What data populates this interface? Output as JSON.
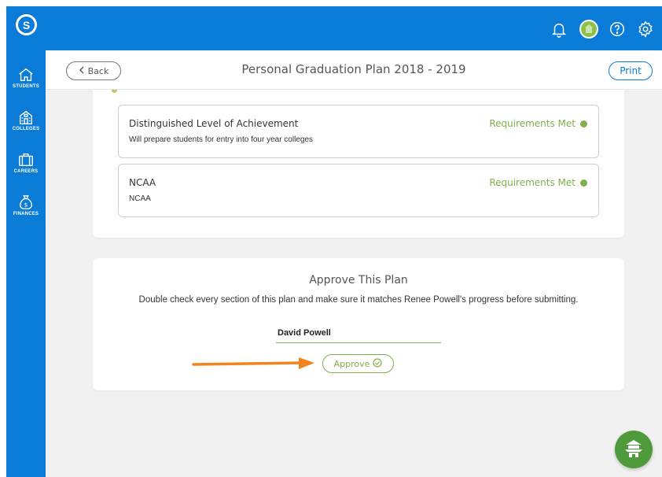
{
  "colors": {
    "brand_blue": "#0a7bd6",
    "accent_green": "#7fb04a",
    "arrow_orange": "#f2841e",
    "fab_green": "#4f9a3a"
  },
  "topbar": {
    "logo_letter": "S",
    "icons": [
      "bell-icon",
      "avatar",
      "help-icon",
      "settings-icon"
    ]
  },
  "sidebar": {
    "items": [
      {
        "label": "STUDENTS",
        "icon": "house-icon"
      },
      {
        "label": "COLLEGES",
        "icon": "building-icon"
      },
      {
        "label": "CAREERS",
        "icon": "briefcase-icon"
      },
      {
        "label": "FINANCES",
        "icon": "money-bag-icon"
      }
    ]
  },
  "header": {
    "back_label": "Back",
    "title": "Personal Graduation Plan 2018 - 2019",
    "print_label": "Print"
  },
  "requirements": [
    {
      "title": "Distinguished Level of Achievement",
      "description": "Will prepare students for entry into four year colleges",
      "status": "Requirements Met"
    },
    {
      "title": "NCAA",
      "description": "NCAA",
      "status": "Requirements Met"
    }
  ],
  "approve": {
    "title": "Approve This Plan",
    "description": "Double check every section of this plan and make sure it matches Renee Powell's progress before submitting.",
    "signature_value": "David Powell",
    "button_label": "Approve"
  }
}
